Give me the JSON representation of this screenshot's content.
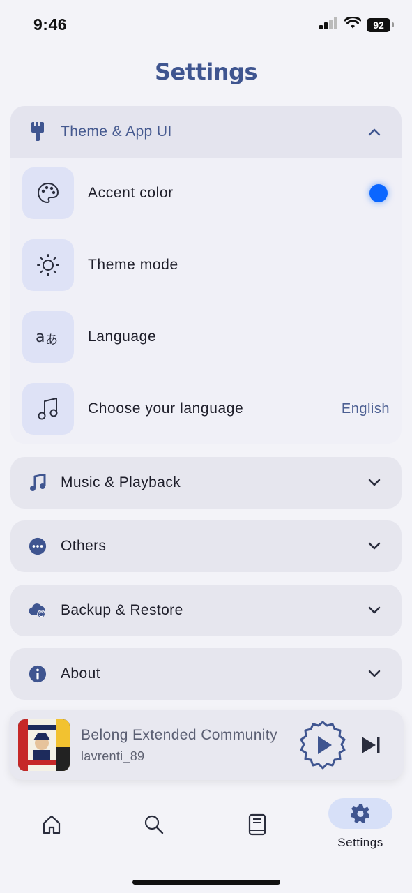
{
  "status_bar": {
    "time": "9:46",
    "battery": "92"
  },
  "page_title": "Settings",
  "theme_section": {
    "label": "Theme & App UI",
    "rows": [
      {
        "label": "Accent color",
        "icon": "palette-icon",
        "accent": "#0a66ff"
      },
      {
        "label": "Theme mode",
        "icon": "sun-icon"
      },
      {
        "label": "Language",
        "icon": "translate-icon"
      },
      {
        "label": "Choose your language",
        "icon": "music-note-icon",
        "value": "English"
      }
    ]
  },
  "sections": [
    {
      "label": "Music & Playback",
      "icon": "music-note-icon"
    },
    {
      "label": "Others",
      "icon": "more-icon"
    },
    {
      "label": "Backup & Restore",
      "icon": "cloud-sync-icon"
    },
    {
      "label": "About",
      "icon": "info-icon"
    }
  ],
  "player": {
    "title": "Belong Extended Community",
    "artist": "lavrenti_89"
  },
  "nav": {
    "items": [
      {
        "name": "home",
        "icon": "home-icon"
      },
      {
        "name": "search",
        "icon": "search-icon"
      },
      {
        "name": "library",
        "icon": "library-icon"
      },
      {
        "name": "settings",
        "icon": "gear-icon",
        "label": "Settings",
        "active": true
      }
    ]
  },
  "colors": {
    "accent": "#3f5590",
    "accent_dot": "#0a66ff",
    "background": "#f3f3f8"
  }
}
